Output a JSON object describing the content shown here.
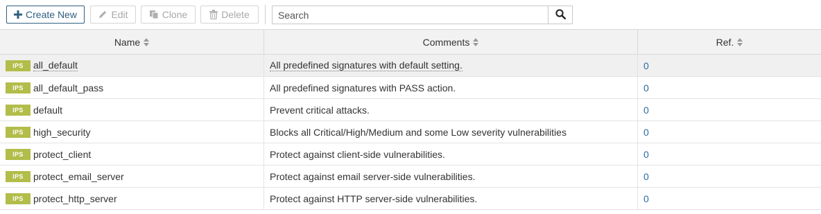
{
  "toolbar": {
    "create_label": "Create New",
    "edit_label": "Edit",
    "clone_label": "Clone",
    "delete_label": "Delete",
    "search_placeholder": "Search"
  },
  "columns": {
    "name": "Name",
    "comments": "Comments",
    "ref": "Ref."
  },
  "rows": [
    {
      "badge": "IPS",
      "name": "all_default",
      "comment": "All predefined signatures with default setting.",
      "ref": "0"
    },
    {
      "badge": "IPS",
      "name": "all_default_pass",
      "comment": "All predefined signatures with PASS action.",
      "ref": "0"
    },
    {
      "badge": "IPS",
      "name": "default",
      "comment": "Prevent critical attacks.",
      "ref": "0"
    },
    {
      "badge": "IPS",
      "name": "high_security",
      "comment": "Blocks all Critical/High/Medium and some Low severity vulnerabilities",
      "ref": "0"
    },
    {
      "badge": "IPS",
      "name": "protect_client",
      "comment": "Protect against client-side vulnerabilities.",
      "ref": "0"
    },
    {
      "badge": "IPS",
      "name": "protect_email_server",
      "comment": "Protect against email server-side vulnerabilities.",
      "ref": "0"
    },
    {
      "badge": "IPS",
      "name": "protect_http_server",
      "comment": "Protect against HTTP server-side vulnerabilities.",
      "ref": "0"
    }
  ]
}
